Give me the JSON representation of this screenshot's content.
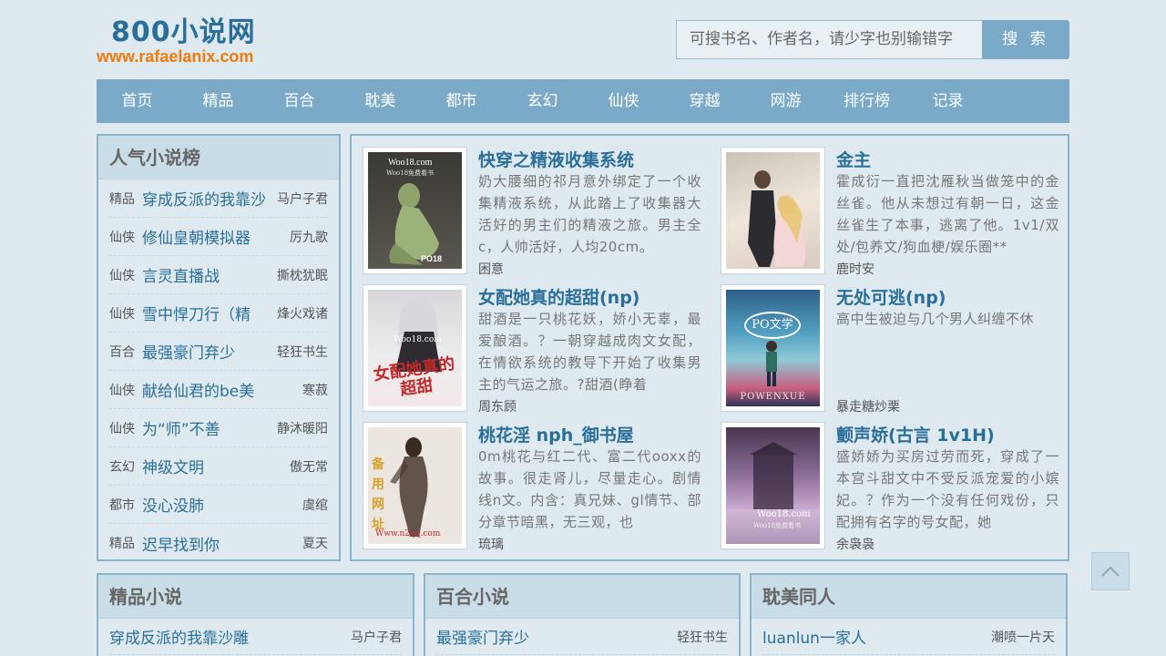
{
  "site": {
    "title": "800小说网",
    "url": "www.rafaelanix.com"
  },
  "search": {
    "placeholder": "可搜书名、作者名，请少字也别输错字",
    "button": "搜 索"
  },
  "nav": [
    "首页",
    "精品",
    "百合",
    "耽美",
    "都市",
    "玄幻",
    "仙侠",
    "穿越",
    "网游",
    "排行榜",
    "记录"
  ],
  "ranking": {
    "title": "人气小说榜",
    "items": [
      {
        "cat": "精品",
        "title": "穿成反派的我靠沙",
        "author": "马户子君"
      },
      {
        "cat": "仙侠",
        "title": "修仙皇朝模拟器",
        "author": "厉九歌"
      },
      {
        "cat": "仙侠",
        "title": "言灵直播战",
        "author": "撕枕犹眠"
      },
      {
        "cat": "仙侠",
        "title": "雪中悍刀行（精",
        "author": "烽火戏诸"
      },
      {
        "cat": "百合",
        "title": "最强豪门弃少",
        "author": "轻狂书生"
      },
      {
        "cat": "仙侠",
        "title": "献给仙君的be美",
        "author": "寒菽"
      },
      {
        "cat": "仙侠",
        "title": "为“师”不善",
        "author": "静沐暖阳"
      },
      {
        "cat": "玄幻",
        "title": "神级文明",
        "author": "傲无常"
      },
      {
        "cat": "都市",
        "title": "没心没肺",
        "author": "虞绾"
      },
      {
        "cat": "精品",
        "title": "迟早找到你",
        "author": "夏天"
      }
    ]
  },
  "featured": [
    {
      "title": "快穿之精液收集系统",
      "desc": "奶大腰细的祁月意外绑定了一个收集精液系统，从此踏上了收集器大活好的男主们的精液之旅。男主全c，人帅活好，人均20cm。",
      "author": "困意",
      "cover_text": "Woo18.com"
    },
    {
      "title": "金主",
      "desc": "霍成衍一直把沈雁秋当做笼中的金丝雀。他从未想过有朝一日，这金丝雀生了本事，逃离了他。1v1/双处/包养文/狗血梗/娱乐圈**",
      "author": "鹿时安",
      "cover_text": ""
    },
    {
      "title": "女配她真的超甜(np)",
      "desc": "甜酒是一只桃花妖，娇小无辜，最爱酿酒。？一朝穿越成肉文女配，在情欲系统的教导下开始了收集男主的气运之旅。?甜酒(睁着",
      "author": "周东顾",
      "cover_text": "女配她真的超甜"
    },
    {
      "title": "无处可逃(np)",
      "desc": "高中生被迫与几个男人纠缠不休",
      "author": "暴走糖炒栗",
      "cover_text": "PO文学"
    },
    {
      "title": "桃花淫 nph_御书屋",
      "desc": "0m桃花与红二代、富二代ooxx的故事。很走肾儿，尽量走心。剧情线n文。内含：真兄妹、gl情节、部分章节暗黑，无三观，也",
      "author": "琉璃",
      "cover_text": "备用网址"
    },
    {
      "title": "颤声娇(古言 1v1H)",
      "desc": "盛娇娇为买房过劳而死，穿成了一本宫斗甜文中不受反派宠爱的小嫔妃。？作为一个没有任何戏份，只配拥有名字的号女配，她",
      "author": "余袅袅",
      "cover_text": "Woo18.com"
    }
  ],
  "cover_extra": {
    "c1_sub": "Woo18免费看书",
    "c1_badge": "PO18",
    "c3_sub": "Woo18.com",
    "c4_bottom": "POWENXUE",
    "c5_url": "Www.n2qq.com",
    "c6_sub": "Woo18免费看书"
  },
  "sections": [
    {
      "title": "精品小说",
      "first": {
        "title": "穿成反派的我靠沙雕",
        "author": "马户子君"
      }
    },
    {
      "title": "百合小说",
      "first": {
        "title": "最强豪门弃少",
        "author": "轻狂书生"
      }
    },
    {
      "title": "耽美同人",
      "first": {
        "title": "luanlun一家人",
        "author": "潮喷一片天"
      }
    }
  ],
  "colors": {
    "accent": "#2a6f99",
    "nav_bg": "#7aaac8",
    "url": "#f07a0a"
  }
}
